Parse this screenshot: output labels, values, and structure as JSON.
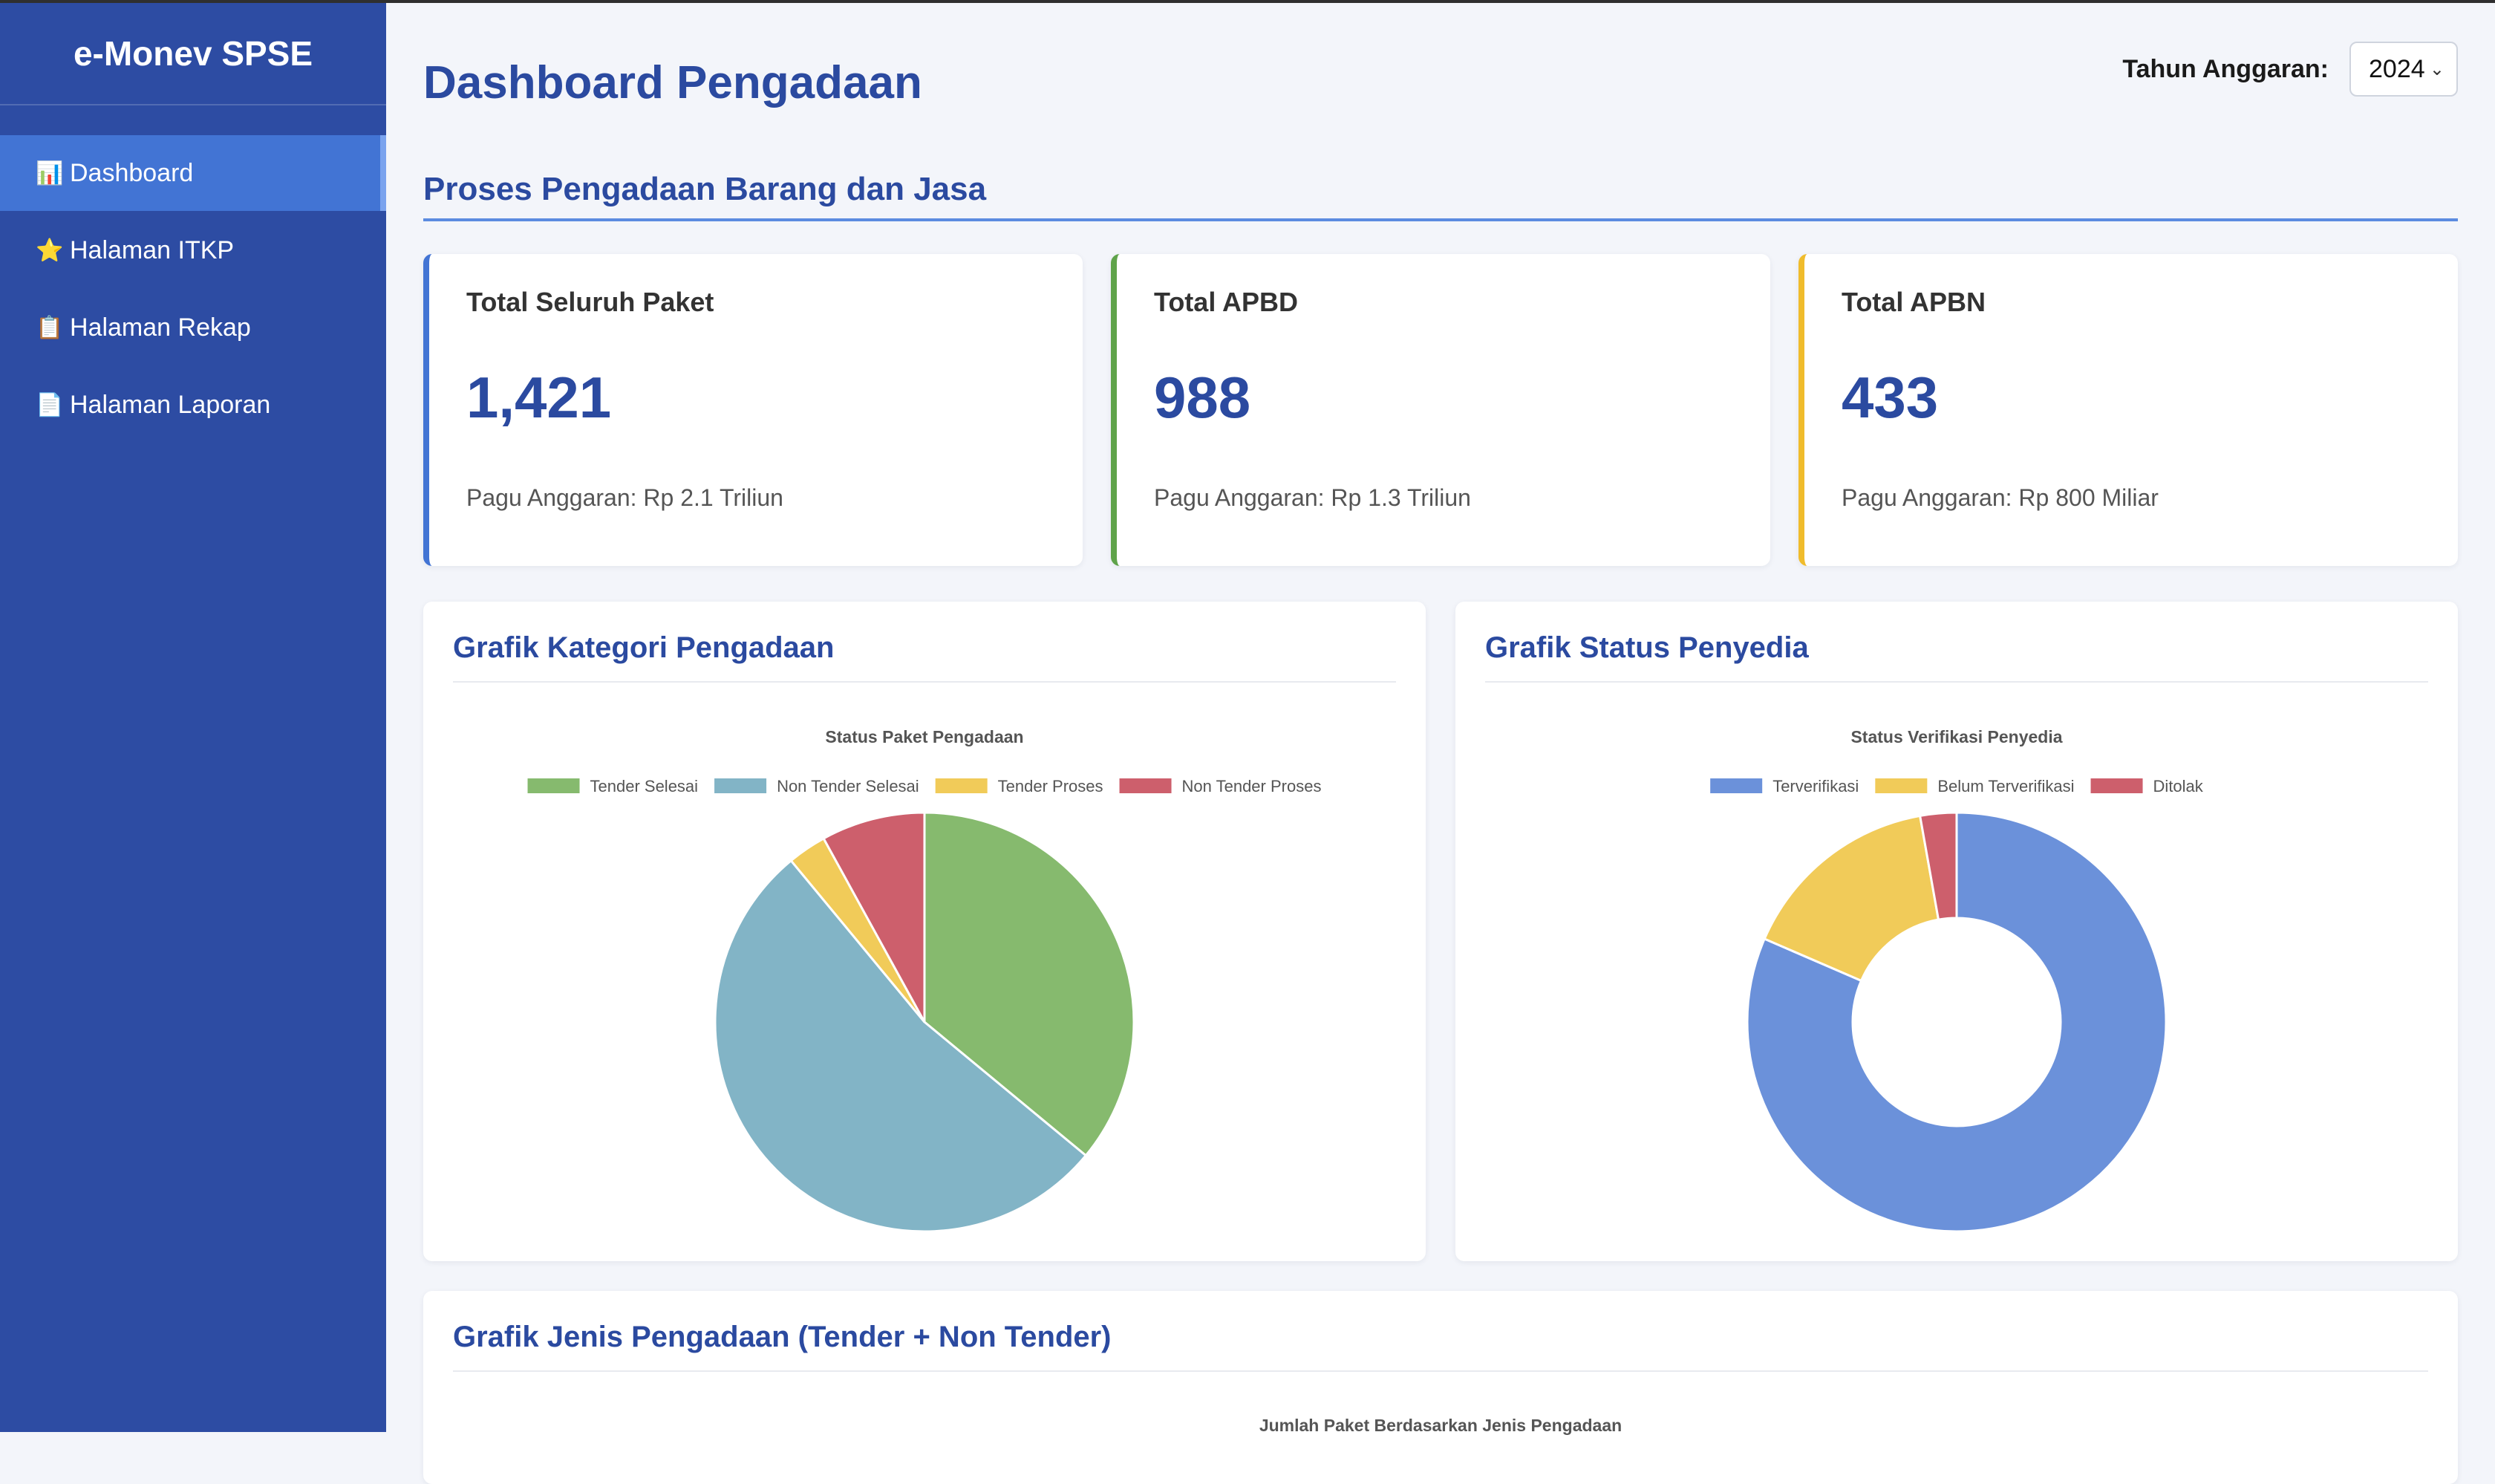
{
  "app": {
    "brand": "e-Monev SPSE"
  },
  "sidebar": {
    "items": [
      {
        "label": "Dashboard",
        "icon": "bar-chart-icon",
        "glyph": "📊",
        "active": true
      },
      {
        "label": "Halaman ITKP",
        "icon": "star-icon",
        "glyph": "⭐",
        "active": false
      },
      {
        "label": "Halaman Rekap",
        "icon": "clipboard-icon",
        "glyph": "📋",
        "active": false
      },
      {
        "label": "Halaman Laporan",
        "icon": "document-icon",
        "glyph": "📄",
        "active": false
      }
    ]
  },
  "header": {
    "title": "Dashboard Pengadaan",
    "year_label": "Tahun Anggaran:",
    "year_value": "2024"
  },
  "section": {
    "title": "Proses Pengadaan Barang dan Jasa"
  },
  "stats": [
    {
      "title": "Total Seluruh Paket",
      "value": "1,421",
      "sub": "Pagu Anggaran: Rp 2.1 Triliun",
      "accent": "#4274d4"
    },
    {
      "title": "Total APBD",
      "value": "988",
      "sub": "Pagu Anggaran: Rp 1.3 Triliun",
      "accent": "#5fa34a"
    },
    {
      "title": "Total APBN",
      "value": "433",
      "sub": "Pagu Anggaran: Rp 800 Miliar",
      "accent": "#f0bc2c"
    }
  ],
  "cards": {
    "kategori_title": "Grafik Kategori Pengadaan",
    "status_title": "Grafik Status Penyedia",
    "jenis_title": "Grafik Jenis Pengadaan (Tender + Non Tender)"
  },
  "chart_data": [
    {
      "type": "pie",
      "title": "Status Paket Pengadaan",
      "legend_position": "top",
      "categories": [
        "Tender Selesai",
        "Non Tender Selesai",
        "Tender Proses",
        "Non Tender Proses"
      ],
      "values": [
        36,
        53,
        3,
        8
      ],
      "colors": [
        "#86ba6e",
        "#82b4c6",
        "#f1cb59",
        "#cd5f6c"
      ]
    },
    {
      "type": "pie",
      "variant": "doughnut",
      "title": "Status Verifikasi Penyedia",
      "legend_position": "top",
      "categories": [
        "Terverifikasi",
        "Belum Terverifikasi",
        "Ditolak"
      ],
      "values": [
        81.5,
        15.7,
        2.8
      ],
      "colors": [
        "#6b91da",
        "#f1cb59",
        "#cd5f6c"
      ]
    },
    {
      "type": "bar",
      "title": "Jumlah Paket Berdasarkan Jenis Pengadaan",
      "categories": [],
      "values": []
    }
  ]
}
